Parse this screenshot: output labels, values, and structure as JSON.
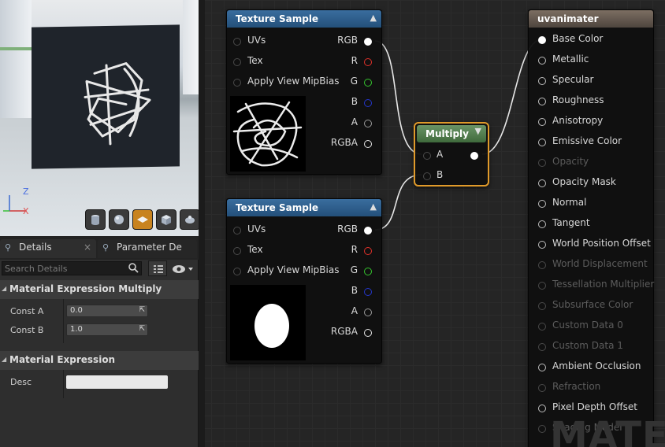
{
  "viewport": {
    "axis_z": "Z",
    "axis_x": "X"
  },
  "details": {
    "tabs": [
      "Details",
      "Parameter De"
    ],
    "search_placeholder": "Search Details",
    "sections": [
      {
        "title": "Material Expression Multiply",
        "rows": [
          {
            "label": "Const A",
            "value": "0.0"
          },
          {
            "label": "Const B",
            "value": "1.0"
          }
        ]
      },
      {
        "title": "Material Expression",
        "rows": [
          {
            "label": "Desc",
            "value": ""
          }
        ]
      }
    ]
  },
  "nodes": {
    "tex1": {
      "title": "Texture Sample",
      "inputs": [
        "UVs",
        "Tex",
        "Apply View MipBias"
      ],
      "outputs": [
        "RGB",
        "R",
        "G",
        "B",
        "A",
        "RGBA"
      ]
    },
    "tex2": {
      "title": "Texture Sample",
      "inputs": [
        "UVs",
        "Tex",
        "Apply View MipBias"
      ],
      "outputs": [
        "RGB",
        "R",
        "G",
        "B",
        "A",
        "RGBA"
      ]
    },
    "multiply": {
      "title": "Multiply",
      "inputs": [
        "A",
        "B"
      ]
    },
    "result": {
      "title": "uvanimater",
      "pins": [
        "Base Color",
        "Metallic",
        "Specular",
        "Roughness",
        "Anisotropy",
        "Emissive Color",
        "Opacity",
        "Opacity Mask",
        "Normal",
        "Tangent",
        "World Position Offset",
        "World Displacement",
        "Tessellation Multiplier",
        "Subsurface Color",
        "Custom Data 0",
        "Custom Data 1",
        "Ambient Occlusion",
        "Refraction",
        "Pixel Depth Offset",
        "Shading Model"
      ],
      "dim_pins": [
        "Opacity",
        "World Displacement",
        "Tessellation Multiplier",
        "Subsurface Color",
        "Custom Data 0",
        "Custom Data 1",
        "Refraction",
        "Shading Model"
      ]
    }
  },
  "watermark": "MATE",
  "colors": {
    "accent": "#d9962a",
    "texture_header": "#2d5d8c",
    "multiply_header": "#557a52",
    "result_header": "#6e6258",
    "pin_r": "#e0312a",
    "pin_g": "#35c42e",
    "pin_b": "#2436c9"
  }
}
